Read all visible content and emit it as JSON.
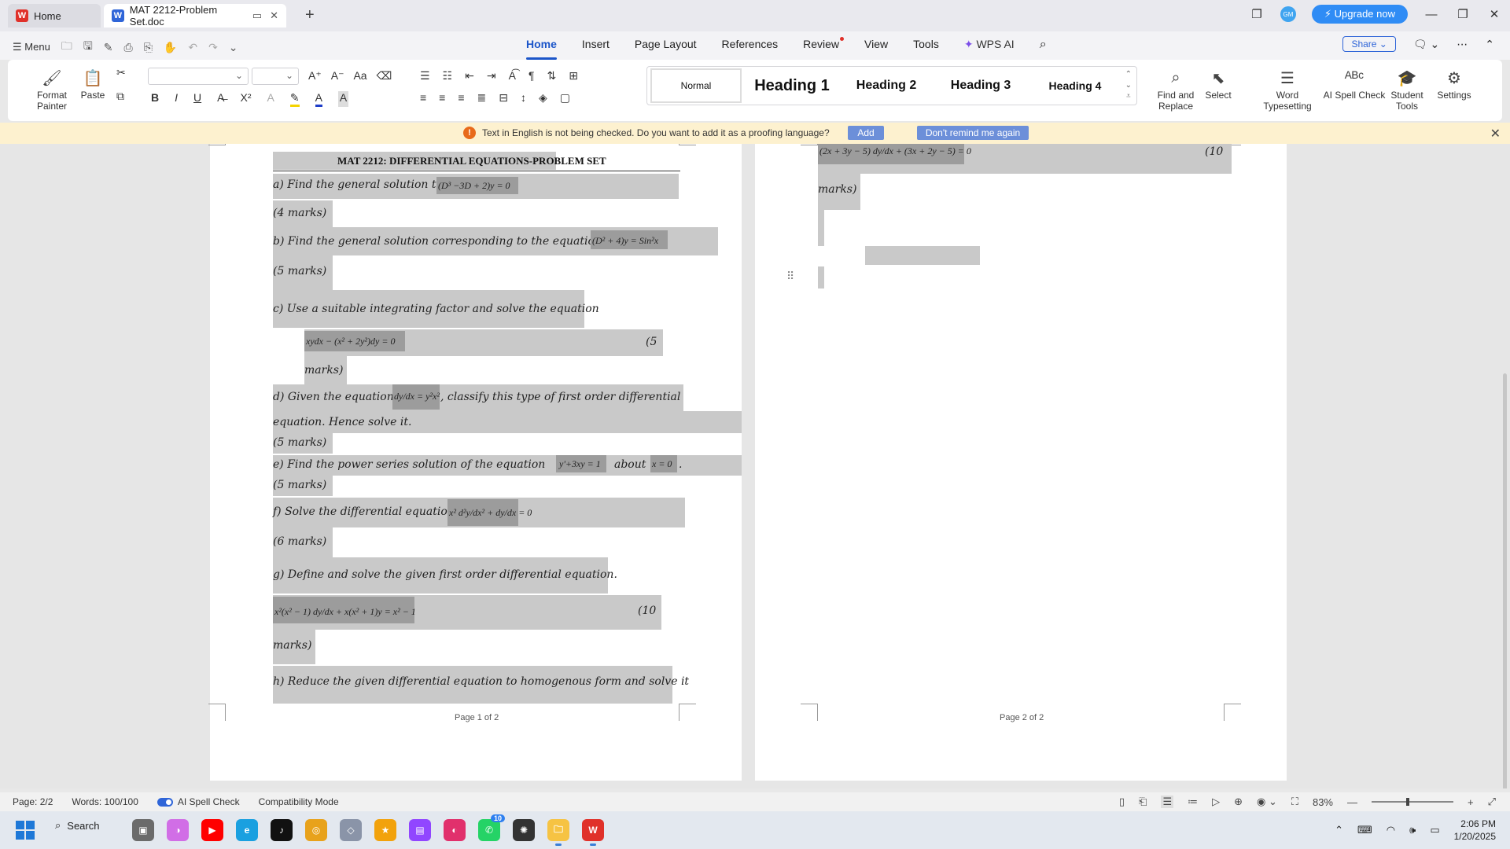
{
  "titlebar": {
    "home_tab": "Home",
    "doc_tab": "MAT 2212-Problem Set.doc",
    "avatar": "GM",
    "upgrade": "Upgrade now"
  },
  "menu": {
    "menu_label": "Menu",
    "tabs": [
      "Home",
      "Insert",
      "Page Layout",
      "References",
      "Review",
      "View",
      "Tools",
      "WPS AI"
    ],
    "share": "Share"
  },
  "ribbon": {
    "format_painter": "Format Painter",
    "paste": "Paste",
    "styles": [
      "Normal",
      "Heading 1",
      "Heading 2",
      "Heading 3",
      "Heading 4"
    ],
    "find_replace": "Find and Replace",
    "select": "Select",
    "word_typesetting": "Word Typesetting",
    "ai_spell_check": "AI Spell Check",
    "student_tools": "Student Tools",
    "settings": "Settings"
  },
  "notice": {
    "message": "Text in English is not being checked. Do you want to add it as a proofing language?",
    "add": "Add",
    "dont_remind": "Don't remind me again"
  },
  "page1": {
    "title": "MAT 2212: DIFFERENTIAL EQUATIONS-PROBLEM SET",
    "a": "a) Find the general solution to",
    "a_eq": "(D³ −3D + 2)y = 0",
    "a_marks": "(4 marks)",
    "b": "b) Find the general solution corresponding to the equation",
    "b_eq": "(D² + 4)y = Sin²x",
    "b_marks": "(5 marks)",
    "c": "c) Use a suitable integrating factor and solve the equation",
    "c_eq": "xydx − (x² + 2y²)dy = 0",
    "c_marks_a": "(5",
    "c_marks_b": "marks)",
    "d_a": "d) Given the equation",
    "d_eq": "dy/dx = y²x²",
    "d_b": ", classify this type of first order differential",
    "d_c": "equation. Hence solve it.",
    "d_marks": "(5 marks)",
    "e_a": "e) Find the power series solution of the equation",
    "e_eq": "y'+3xy = 1",
    "e_about": "about",
    "e_x": "x = 0",
    "e_dot": ".",
    "e_marks": "(5 marks)",
    "f": "f) Solve the differential equation",
    "f_eq": "x² d²y/dx² + dy/dx = 0",
    "f_marks": "(6 marks)",
    "g": "g) Define and solve the given first order differential equation.",
    "g_eq": "x²(x² − 1) dy/dx + x(x² + 1)y = x² − 1",
    "g_marks_a": "(10",
    "g_marks_b": "marks)",
    "h": "h) Reduce the given differential equation to homogenous form and solve it",
    "page_label": "Page 1 of 2"
  },
  "page2": {
    "eq": "(2x + 3y − 5) dy/dx + (3x + 2y − 5) = 0",
    "marks_a": "(10",
    "marks_b": "marks)",
    "page_label": "Page 2 of 2"
  },
  "status": {
    "page": "Page: 2/2",
    "words": "Words: 100/100",
    "spell": "AI Spell Check",
    "mode": "Compatibility Mode",
    "zoom": "83%",
    "zoom_level": 0.42
  },
  "taskbar": {
    "search": "Search",
    "whatsapp_badge": "10",
    "time": "2:06 PM",
    "date": "1/20/2025"
  }
}
